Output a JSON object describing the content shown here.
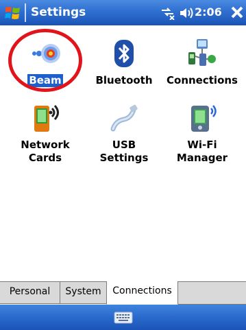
{
  "titlebar": {
    "title": "Settings",
    "clock": "2:06",
    "icons": [
      "windows-start-icon",
      "connectivity-icon",
      "volume-icon",
      "close-icon"
    ]
  },
  "items": [
    {
      "label": "Beam",
      "icon": "beam-icon",
      "selected": true
    },
    {
      "label": "Bluetooth",
      "icon": "bluetooth-icon"
    },
    {
      "label": "Connections",
      "icon": "connections-icon"
    },
    {
      "label": "Network\nCards",
      "icon": "network-cards-icon"
    },
    {
      "label": "USB\nSettings",
      "icon": "usb-icon"
    },
    {
      "label": "Wi-Fi\nManager",
      "icon": "wifi-manager-icon"
    }
  ],
  "tabs": [
    {
      "label": "Personal"
    },
    {
      "label": "System"
    },
    {
      "label": "Connections",
      "active": true
    }
  ],
  "menubar": {
    "icon": "keyboard-icon"
  },
  "colors": {
    "titlebar": "#2f6fd0",
    "selection": "#1e5fcc",
    "highlight_circle": "#e0141a",
    "tab_inactive": "#d9d9d9"
  }
}
